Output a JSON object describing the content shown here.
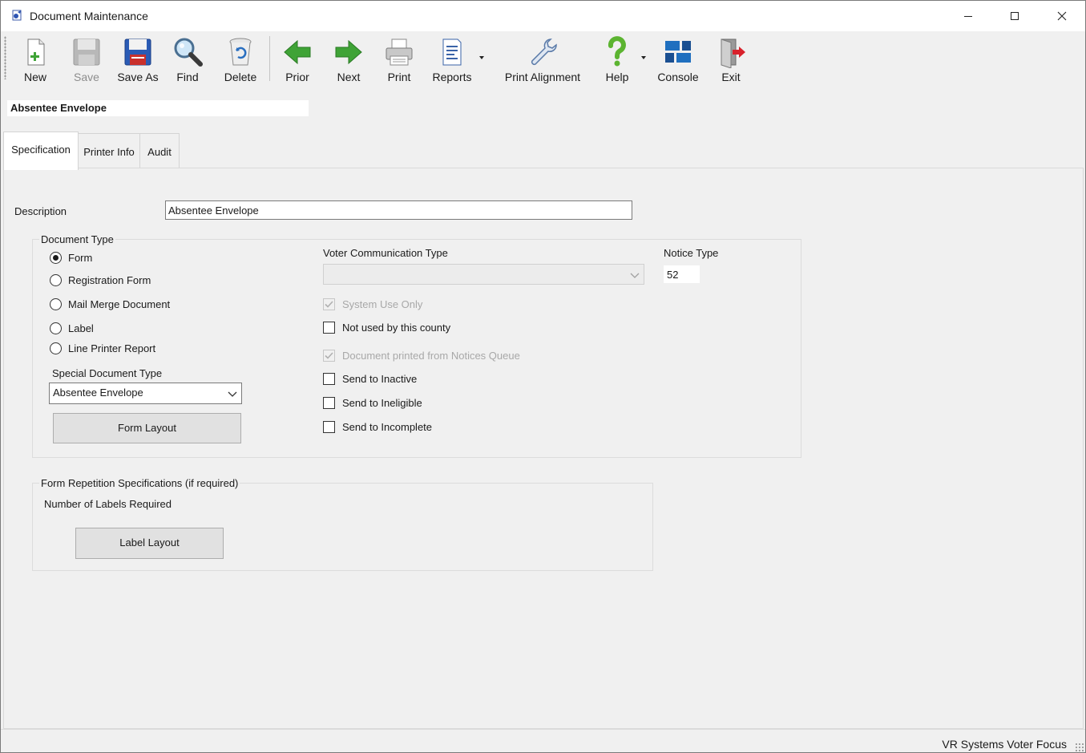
{
  "window": {
    "title": "Document Maintenance"
  },
  "toolbar": {
    "new": "New",
    "save": "Save",
    "save_as": "Save As",
    "find": "Find",
    "delete": "Delete",
    "prior": "Prior",
    "next": "Next",
    "print": "Print",
    "reports": "Reports",
    "print_alignment": "Print Alignment",
    "help": "Help",
    "console": "Console",
    "exit": "Exit"
  },
  "record": {
    "title": "Absentee Envelope"
  },
  "tabs": [
    {
      "label": "Specification",
      "active": true
    },
    {
      "label": "Printer Info",
      "active": false
    },
    {
      "label": "Audit",
      "active": false
    }
  ],
  "specification": {
    "description_label": "Description",
    "description_value": "Absentee Envelope",
    "document_type": {
      "title": "Document Type",
      "options": [
        "Form",
        "Registration Form",
        "Mail Merge Document",
        "Label",
        "Line Printer Report"
      ],
      "selected": "Form"
    },
    "special_document_type": {
      "label": "Special Document Type",
      "value": "Absentee Envelope"
    },
    "form_layout_button": "Form Layout",
    "voter_communication_type": {
      "label": "Voter Communication Type",
      "value": ""
    },
    "notice_type": {
      "label": "Notice Type",
      "value": "52"
    },
    "checkboxes": {
      "system_use_only": {
        "label": "System Use Only",
        "checked": true,
        "enabled": false
      },
      "not_used_by_county": {
        "label": "Not used by this county",
        "checked": false,
        "enabled": true
      },
      "printed_from_queue": {
        "label": "Document printed from Notices Queue",
        "checked": true,
        "enabled": false
      },
      "send_to_inactive": {
        "label": "Send to Inactive",
        "checked": false,
        "enabled": true
      },
      "send_to_ineligible": {
        "label": "Send to Ineligible",
        "checked": false,
        "enabled": true
      },
      "send_to_incomplete": {
        "label": "Send to Incomplete",
        "checked": false,
        "enabled": true
      }
    },
    "form_repetition": {
      "title": "Form Repetition Specifications (if required)",
      "labels_required": "Number of Labels Required",
      "label_layout_button": "Label Layout"
    }
  },
  "status_bar": {
    "text": "VR Systems Voter Focus"
  },
  "icons": {
    "app": "document-maintenance-icon",
    "new": "new-document-icon",
    "save": "floppy-disk-icon",
    "save_as": "floppy-disk-icon",
    "find": "magnifier-icon",
    "delete": "recycle-bin-icon",
    "prior": "green-arrow-left-icon",
    "next": "green-arrow-right-icon",
    "print": "printer-icon",
    "reports": "report-icon",
    "print_alignment": "wrench-icon",
    "help": "question-mark-icon",
    "console": "console-icon",
    "exit": "exit-door-icon"
  },
  "colors": {
    "accent_green": "#3fa336",
    "help_green": "#5cb431",
    "exit_red": "#d8212b",
    "console_blue": "#1f6fbf"
  }
}
